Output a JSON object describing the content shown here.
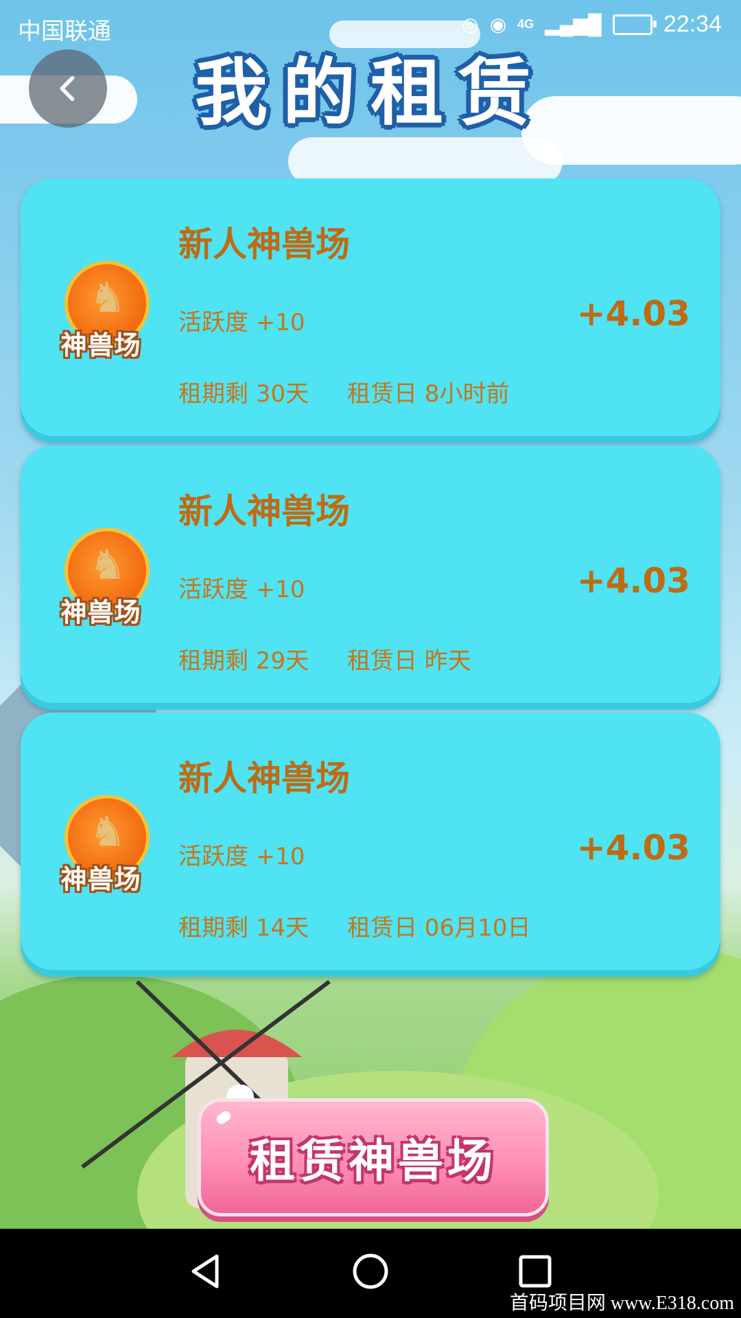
{
  "status_bar": {
    "carrier": "中国联通",
    "network": "4G",
    "time": "22:34"
  },
  "header": {
    "title": "我的租赁"
  },
  "rentals": [
    {
      "name": "新人神兽场",
      "logo_text": "神兽场",
      "activity": "活跃度 +10",
      "term": "租期剩 30天",
      "rent_date": "租赁日 8小时前",
      "amount": "+4.03"
    },
    {
      "name": "新人神兽场",
      "logo_text": "神兽场",
      "activity": "活跃度 +10",
      "term": "租期剩 29天",
      "rent_date": "租赁日 昨天",
      "amount": "+4.03"
    },
    {
      "name": "新人神兽场",
      "logo_text": "神兽场",
      "activity": "活跃度 +10",
      "term": "租期剩 14天",
      "rent_date": "租赁日 06月10日",
      "amount": "+4.03"
    }
  ],
  "action_button": {
    "label": "租赁神兽场"
  },
  "navbar": {
    "icons": [
      "back-triangle-icon",
      "home-circle-icon",
      "recents-square-icon"
    ]
  },
  "watermark": "首码项目网 www.E318.com",
  "colors": {
    "card": "#4fe3f4",
    "card_text": "#c06a12",
    "button": "#ff8fb4"
  }
}
